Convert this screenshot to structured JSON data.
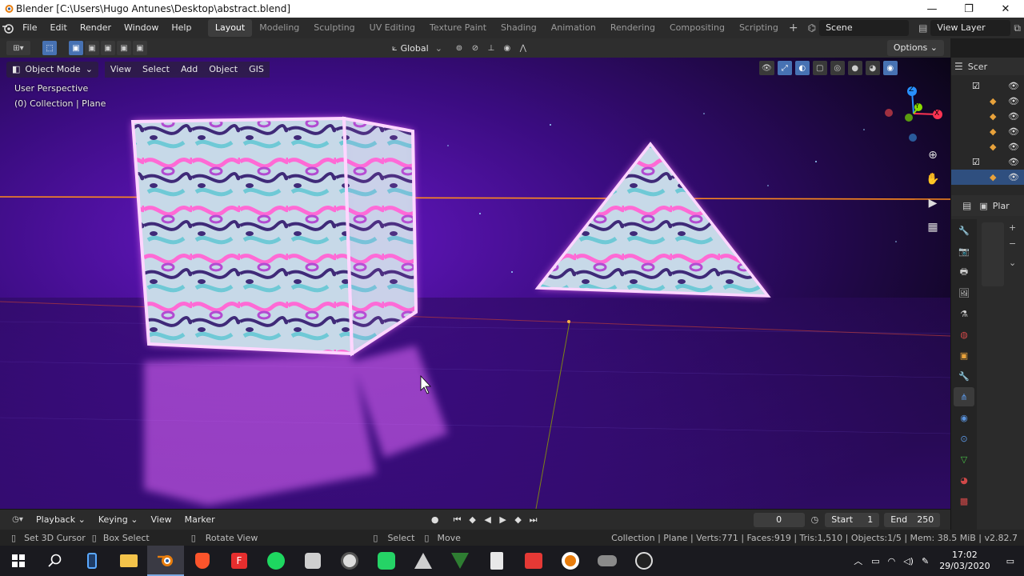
{
  "window": {
    "title": "Blender [C:\\Users\\Hugo Antunes\\Desktop\\abstract.blend]",
    "min_glyph": "—",
    "max_glyph": "❐",
    "close_glyph": "✕"
  },
  "topbar": {
    "menus": [
      "File",
      "Edit",
      "Render",
      "Window",
      "Help"
    ],
    "workspaces": [
      "Layout",
      "Modeling",
      "Sculpting",
      "UV Editing",
      "Texture Paint",
      "Shading",
      "Animation",
      "Rendering",
      "Compositing",
      "Scripting"
    ],
    "active_workspace": "Layout",
    "add_workspace": "+",
    "scene": "Scene",
    "view_layer": "View Layer"
  },
  "tool_header": {
    "orientation": "Global",
    "options_label": "Options"
  },
  "viewport": {
    "mode": "Object Mode",
    "menus": [
      "View",
      "Select",
      "Add",
      "Object",
      "GIS"
    ],
    "perspective_label": "User Perspective",
    "collection_label": "(0) Collection | Plane",
    "gizmo_axes": {
      "x": "X",
      "y": "Y",
      "z": "Z"
    }
  },
  "outliner": {
    "header_label": "Scer"
  },
  "properties": {
    "header_label": "Plar"
  },
  "timeline": {
    "menus": [
      "Playback",
      "Keying",
      "View",
      "Marker"
    ],
    "current_frame": "0",
    "start_label": "Start",
    "start_value": "1",
    "end_label": "End",
    "end_value": "250"
  },
  "statusbar": {
    "hint_1": "Set 3D Cursor",
    "hint_2": "Box Select",
    "hint_3": "Rotate View",
    "hint_4": "Select",
    "hint_5": "Move",
    "stats": "Collection | Plane | Verts:771 | Faces:919 | Tris:1,510 | Objects:1/5 | Mem: 38.5 MiB | v2.82.7"
  },
  "taskbar": {
    "time": "17:02",
    "date": "29/03/2020",
    "apps": [
      "windows-start",
      "search",
      "phone",
      "file-explorer",
      "blender",
      "brave",
      "foxit",
      "spotify",
      "app-settings",
      "clock",
      "whatsapp",
      "inkscape",
      "vpn",
      "calculator",
      "video-downloader",
      "blender-2",
      "game",
      "obs"
    ]
  },
  "colors": {
    "accent_blue": "#4772b3",
    "neon_pink": "#ff7bff",
    "axis_x": "#ff3352",
    "axis_y": "#8bdc00",
    "axis_z": "#2890ff",
    "orange_line": "#ff8a1d"
  }
}
